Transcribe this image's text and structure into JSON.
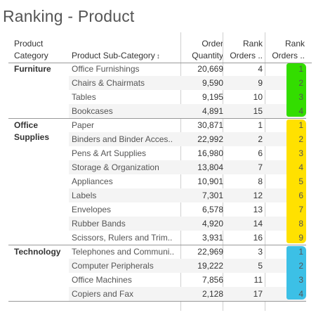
{
  "page": {
    "title": "Ranking - Product"
  },
  "headers": {
    "category": [
      "Product",
      "Category"
    ],
    "subcategory": "Product Sub-Category",
    "quantity": [
      "Order",
      "Quantity"
    ],
    "rank1": [
      "Rank",
      "Orders .."
    ],
    "rank2": [
      "Rank",
      "Orders .."
    ]
  },
  "colors": {
    "furniture": "#33dd00",
    "office_supplies": "#ffe100",
    "technology": "#3cc0e6"
  },
  "groups": [
    {
      "category": [
        "Furniture"
      ],
      "highlight": "furniture",
      "rows": [
        {
          "subcategory": "Office Furnishings",
          "quantity": "20,669",
          "rank": "4",
          "rank_in_group": "1"
        },
        {
          "subcategory": "Chairs & Chairmats",
          "quantity": "9,590",
          "rank": "9",
          "rank_in_group": "2"
        },
        {
          "subcategory": "Tables",
          "quantity": "9,195",
          "rank": "10",
          "rank_in_group": "3"
        },
        {
          "subcategory": "Bookcases",
          "quantity": "4,891",
          "rank": "15",
          "rank_in_group": "4"
        }
      ]
    },
    {
      "category": [
        "Office",
        "Supplies"
      ],
      "highlight": "office_supplies",
      "rows": [
        {
          "subcategory": "Paper",
          "quantity": "30,871",
          "rank": "1",
          "rank_in_group": "1"
        },
        {
          "subcategory": "Binders and Binder Acces..",
          "quantity": "22,992",
          "rank": "2",
          "rank_in_group": "2"
        },
        {
          "subcategory": "Pens & Art Supplies",
          "quantity": "16,980",
          "rank": "6",
          "rank_in_group": "3"
        },
        {
          "subcategory": "Storage & Organization",
          "quantity": "13,804",
          "rank": "7",
          "rank_in_group": "4"
        },
        {
          "subcategory": "Appliances",
          "quantity": "10,901",
          "rank": "8",
          "rank_in_group": "5"
        },
        {
          "subcategory": "Labels",
          "quantity": "7,301",
          "rank": "12",
          "rank_in_group": "6"
        },
        {
          "subcategory": "Envelopes",
          "quantity": "6,578",
          "rank": "13",
          "rank_in_group": "7"
        },
        {
          "subcategory": "Rubber Bands",
          "quantity": "4,920",
          "rank": "14",
          "rank_in_group": "8"
        },
        {
          "subcategory": "Scissors, Rulers and Trim..",
          "quantity": "3,931",
          "rank": "16",
          "rank_in_group": "9"
        }
      ]
    },
    {
      "category": [
        "Technology"
      ],
      "highlight": "technology",
      "rows": [
        {
          "subcategory": "Telephones and Communi..",
          "quantity": "22,969",
          "rank": "3",
          "rank_in_group": "1"
        },
        {
          "subcategory": "Computer Peripherals",
          "quantity": "19,222",
          "rank": "5",
          "rank_in_group": "2"
        },
        {
          "subcategory": "Office Machines",
          "quantity": "7,856",
          "rank": "11",
          "rank_in_group": "3"
        },
        {
          "subcategory": "Copiers and Fax",
          "quantity": "2,128",
          "rank": "17",
          "rank_in_group": "4"
        }
      ]
    }
  ]
}
